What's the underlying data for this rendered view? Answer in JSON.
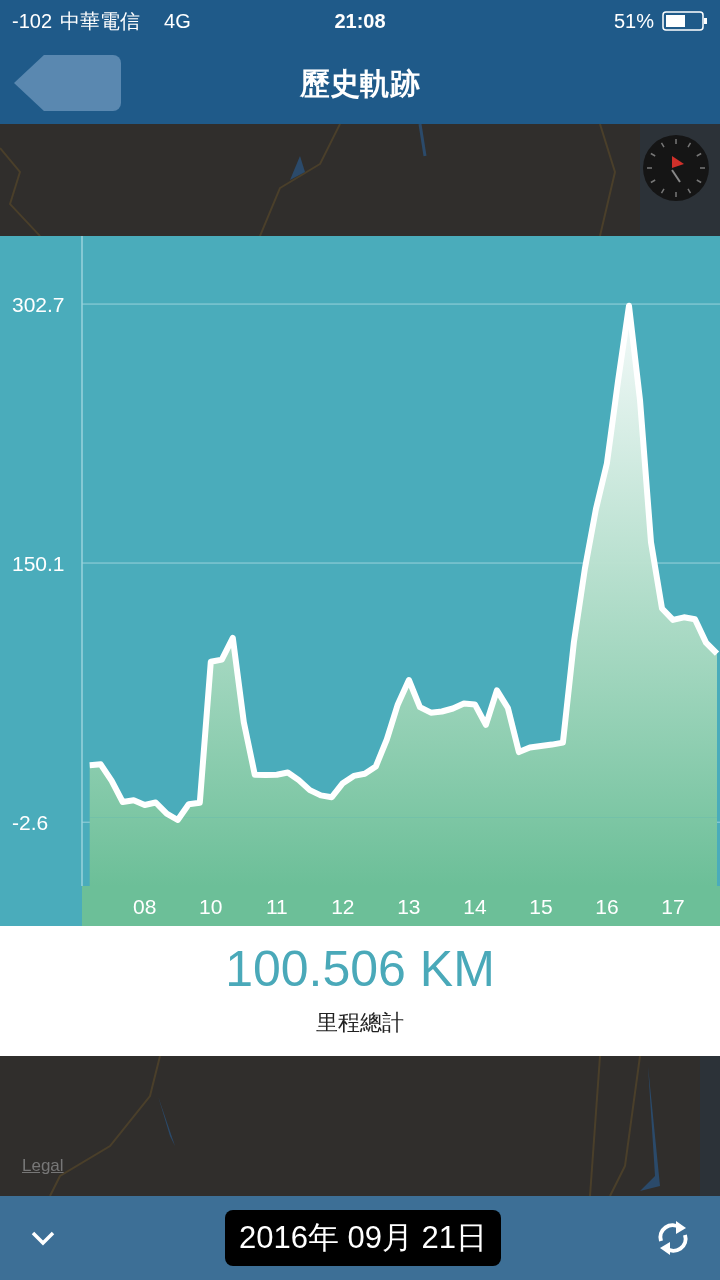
{
  "status_bar": {
    "signal": "-102",
    "carrier": "中華電信",
    "network": "4G",
    "time": "21:08",
    "battery": "51%"
  },
  "nav": {
    "title": "歷史軌跡"
  },
  "chart": {
    "chart_data": {
      "type": "area",
      "grid": true,
      "ylim": [
        -40.2,
        342.8
      ],
      "yticks": [
        -2.6,
        150.1,
        302.7
      ],
      "categories": [
        null,
        null,
        null,
        null,
        null,
        "08",
        null,
        null,
        null,
        null,
        null,
        "10",
        null,
        null,
        null,
        null,
        null,
        "11",
        null,
        null,
        null,
        null,
        null,
        "12",
        null,
        null,
        null,
        null,
        null,
        "13",
        null,
        null,
        null,
        null,
        null,
        "14",
        null,
        null,
        null,
        null,
        null,
        "15",
        null,
        null,
        null,
        null,
        null,
        "16",
        null,
        null,
        null,
        null,
        null,
        "17",
        null,
        null,
        null,
        null
      ],
      "series": [
        {
          "color": "#ffffff",
          "values": [
            31.0,
            31.5,
            21.8,
            9.3,
            10.3,
            7.5,
            9.0,
            2.4,
            -1.3,
            8.0,
            8.8,
            91.9,
            93.2,
            106.0,
            56.4,
            25.3,
            25.2,
            25.4,
            26.7,
            22.2,
            16.3,
            13.2,
            12.1,
            20.4,
            24.7,
            25.9,
            30.2,
            46.1,
            66.8,
            81.2,
            65.2,
            61.9,
            62.6,
            64.4,
            67.3,
            66.8,
            54.7,
            75.1,
            64.7,
            38.7,
            41.4,
            42.3,
            43.1,
            44.3,
            103.5,
            146.8,
            181.8,
            208.8,
            257.1,
            301.7,
            246.1,
            162.4,
            123.3,
            116.6,
            118.1,
            117.0,
            103.2,
            96.7
          ]
        }
      ]
    }
  },
  "summary": {
    "distance": "100.506 KM",
    "label": "里程總計"
  },
  "map": {
    "legal": "Legal"
  },
  "bottom_bar": {
    "date": "2016年 09月 21日"
  }
}
